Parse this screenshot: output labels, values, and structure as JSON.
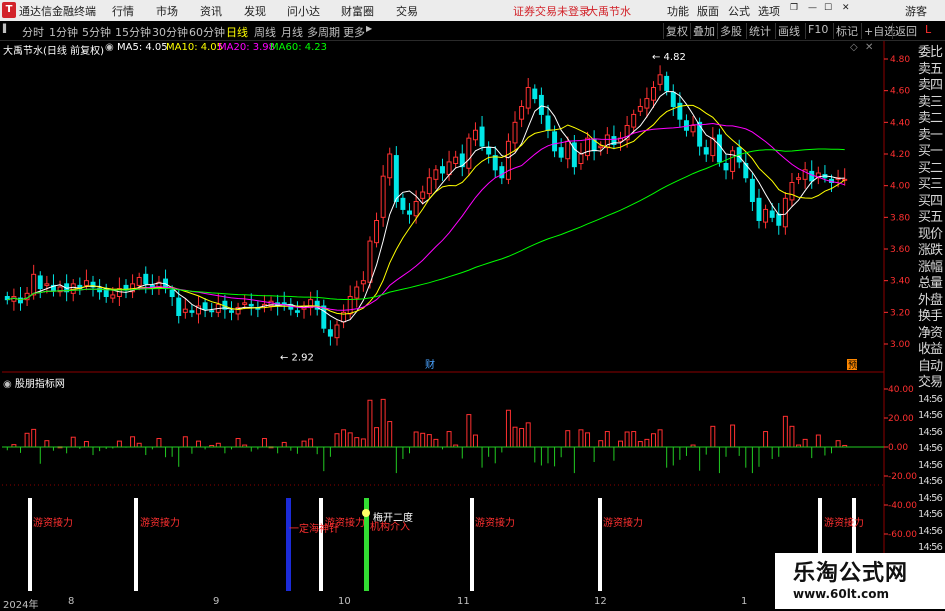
{
  "titlebar": {
    "app_title": "通达信金融终端",
    "menus": [
      "行情",
      "市场",
      "资讯",
      "发现",
      "问小达",
      "财富圈",
      "交易"
    ],
    "notice": "证券交易未登录",
    "stock_name": "大禹节水",
    "right_menus": [
      "功能",
      "版面",
      "公式",
      "选项"
    ],
    "guest": "游客"
  },
  "toolbar": {
    "periods": [
      "分时",
      "1分钟",
      "5分钟",
      "15分钟",
      "30分钟",
      "60分钟",
      "日线",
      "周线",
      "月线",
      "多周期",
      "更多"
    ],
    "active": "日线",
    "right_buttons": [
      "复权",
      "叠加",
      "多股",
      "统计",
      "画线",
      "F10",
      "标记",
      "+自选",
      "返回"
    ]
  },
  "chart_head": {
    "stock": "大禹节水",
    "mode": "(日线 前复权)",
    "ma5": "MA5: 4.05",
    "ma10": "MA10: 4.05",
    "ma20": "MA20: 3.98",
    "ma60": "MA60: 4.23",
    "high_label": "4.82",
    "low_label": "2.92",
    "badge_cai": "财",
    "badge_yu": "预"
  },
  "colors": {
    "up": "#ff3232",
    "down": "#00e6e6",
    "ma5": "#ffffff",
    "ma10": "#ffff00",
    "ma20": "#ff00ff",
    "ma60": "#00ff00",
    "grid": "#8b0000"
  },
  "price_axis": [
    "4.80",
    "4.60",
    "4.40",
    "4.20",
    "4.00",
    "3.80",
    "3.60",
    "3.40",
    "3.20",
    "3.00"
  ],
  "indicator": {
    "title": "股朋指标网",
    "axis": [
      "40.00",
      "20.00",
      "0.00",
      "-20.00",
      "-40.00",
      "-60.00"
    ],
    "signals": [
      {
        "text": "游资接力",
        "color": "#ff3030"
      },
      {
        "text": "游资接力",
        "color": "#ff3030"
      },
      {
        "text": "一定海神针",
        "color": "#ff3030"
      },
      {
        "text": "游资接力",
        "color": "#ff3030"
      },
      {
        "text": "梅开二度",
        "color": "#ffffff"
      },
      {
        "text": "机构介入",
        "color": "#ff3030"
      },
      {
        "text": "游资接力",
        "color": "#ff3030"
      },
      {
        "text": "游资接力",
        "color": "#ff3030"
      },
      {
        "text": "游资接力",
        "color": "#ff3030"
      }
    ]
  },
  "right_panel": [
    "委比",
    "卖五",
    "卖四",
    "卖三",
    "卖二",
    "卖一",
    "买一",
    "买二",
    "买三",
    "买四",
    "买五",
    "现价",
    "涨跌",
    "涨幅",
    "总量",
    "外盘",
    "换手",
    "净资",
    "收益",
    "自动",
    "交易",
    "14:56",
    "14:56",
    "14:56",
    "14:56",
    "14:56",
    "14:56",
    "14:56",
    "14:56",
    "14:56",
    "14:56"
  ],
  "dates": [
    "2024年",
    "8",
    "9",
    "10",
    "11",
    "12",
    "1"
  ],
  "watermark": {
    "title": "乐淘公式网",
    "url": "www.60lt.com"
  }
}
